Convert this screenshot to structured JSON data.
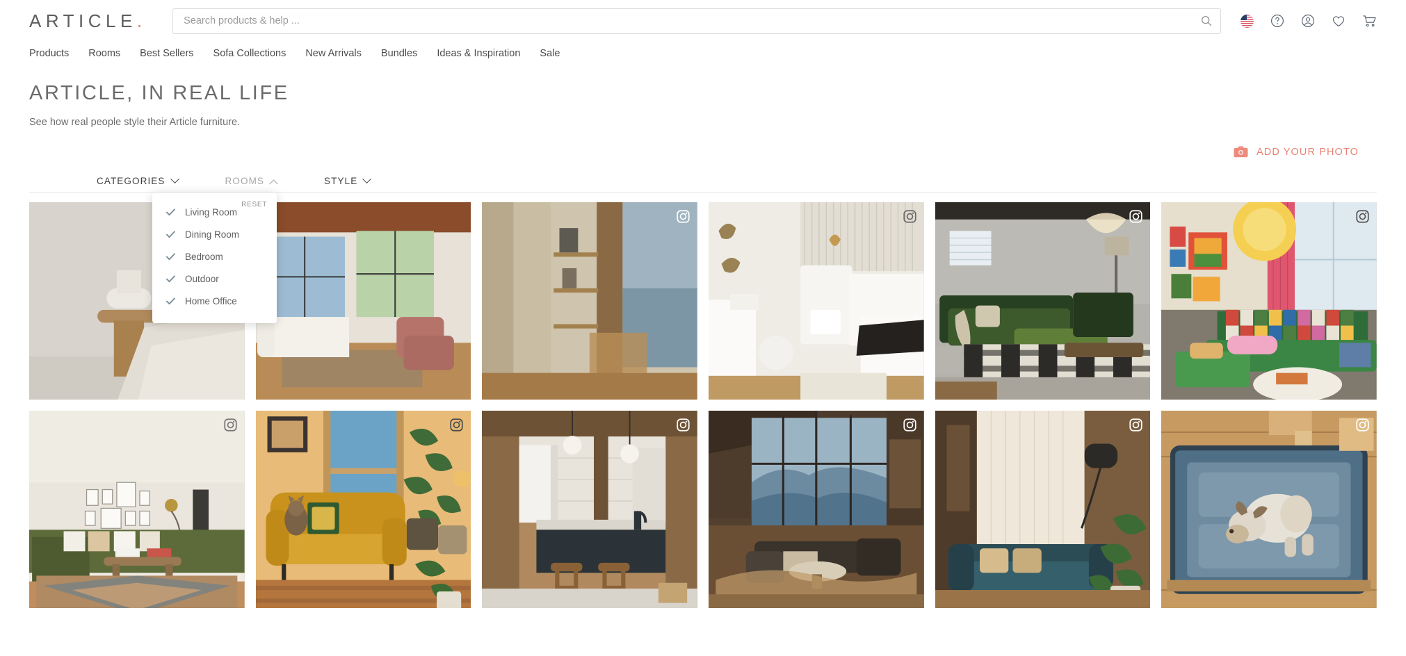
{
  "header": {
    "logo_text": "ARTICLE",
    "logo_dot": ".",
    "search_placeholder": "Search products & help ...",
    "search_value": "",
    "icons": [
      {
        "name": "flag-icon",
        "label": "US"
      },
      {
        "name": "help-icon",
        "label": "?"
      },
      {
        "name": "account-icon",
        "label": "Account"
      },
      {
        "name": "wishlist-icon",
        "label": "Wishlist"
      },
      {
        "name": "cart-icon",
        "label": "Cart"
      }
    ]
  },
  "nav": {
    "items": [
      {
        "label": "Products"
      },
      {
        "label": "Rooms"
      },
      {
        "label": "Best Sellers"
      },
      {
        "label": "Sofa Collections"
      },
      {
        "label": "New Arrivals"
      },
      {
        "label": "Bundles"
      },
      {
        "label": "Ideas & Inspiration"
      },
      {
        "label": "Sale"
      }
    ]
  },
  "page": {
    "title": "ARTICLE, IN REAL LIFE",
    "subtitle": "See how real people style their Article furniture."
  },
  "add_photo": {
    "label": "ADD YOUR PHOTO",
    "icon": "camera-icon",
    "color": "#e98376"
  },
  "filters": {
    "buttons": [
      {
        "label": "CATEGORIES",
        "state": "closed",
        "chevron": "chevron-down"
      },
      {
        "label": "ROOMS",
        "state": "open",
        "chevron": "chevron-up"
      },
      {
        "label": "STYLE",
        "state": "closed",
        "chevron": "chevron-down"
      }
    ],
    "dropdown": {
      "owner": "ROOMS",
      "reset_label": "RESET",
      "options": [
        {
          "label": "Living Room",
          "checked": true
        },
        {
          "label": "Dining Room",
          "checked": true
        },
        {
          "label": "Bedroom",
          "checked": true
        },
        {
          "label": "Outdoor",
          "checked": true
        },
        {
          "label": "Home Office",
          "checked": true
        }
      ]
    }
  },
  "gallery": {
    "tiles": [
      {
        "id": "tile-1",
        "alt": "Bedroom with wood side table and lamp",
        "instagram": false
      },
      {
        "id": "tile-2",
        "alt": "Living room with white sofa and pink chairs",
        "instagram": false
      },
      {
        "id": "tile-3",
        "alt": "Wood shelf with plants by window",
        "instagram": true
      },
      {
        "id": "tile-4",
        "alt": "White bedroom with slatted wall",
        "instagram": true
      },
      {
        "id": "tile-5",
        "alt": "Green velvet sectional in basement",
        "instagram": true
      },
      {
        "id": "tile-6",
        "alt": "Colorful living room with green sofa",
        "instagram": true
      },
      {
        "id": "tile-7",
        "alt": "Olive sectional with gallery wall",
        "instagram": true
      },
      {
        "id": "tile-8",
        "alt": "Mustard armchair with cat and plants",
        "instagram": true
      },
      {
        "id": "tile-9",
        "alt": "Wood kitchen with counter stools",
        "instagram": true
      },
      {
        "id": "tile-10",
        "alt": "Cabin living room with large windows",
        "instagram": true
      },
      {
        "id": "tile-11",
        "alt": "Teal sofa with plants and floor lamp",
        "instagram": true
      },
      {
        "id": "tile-12",
        "alt": "Dog on blue sofa from above",
        "instagram": true
      }
    ]
  }
}
